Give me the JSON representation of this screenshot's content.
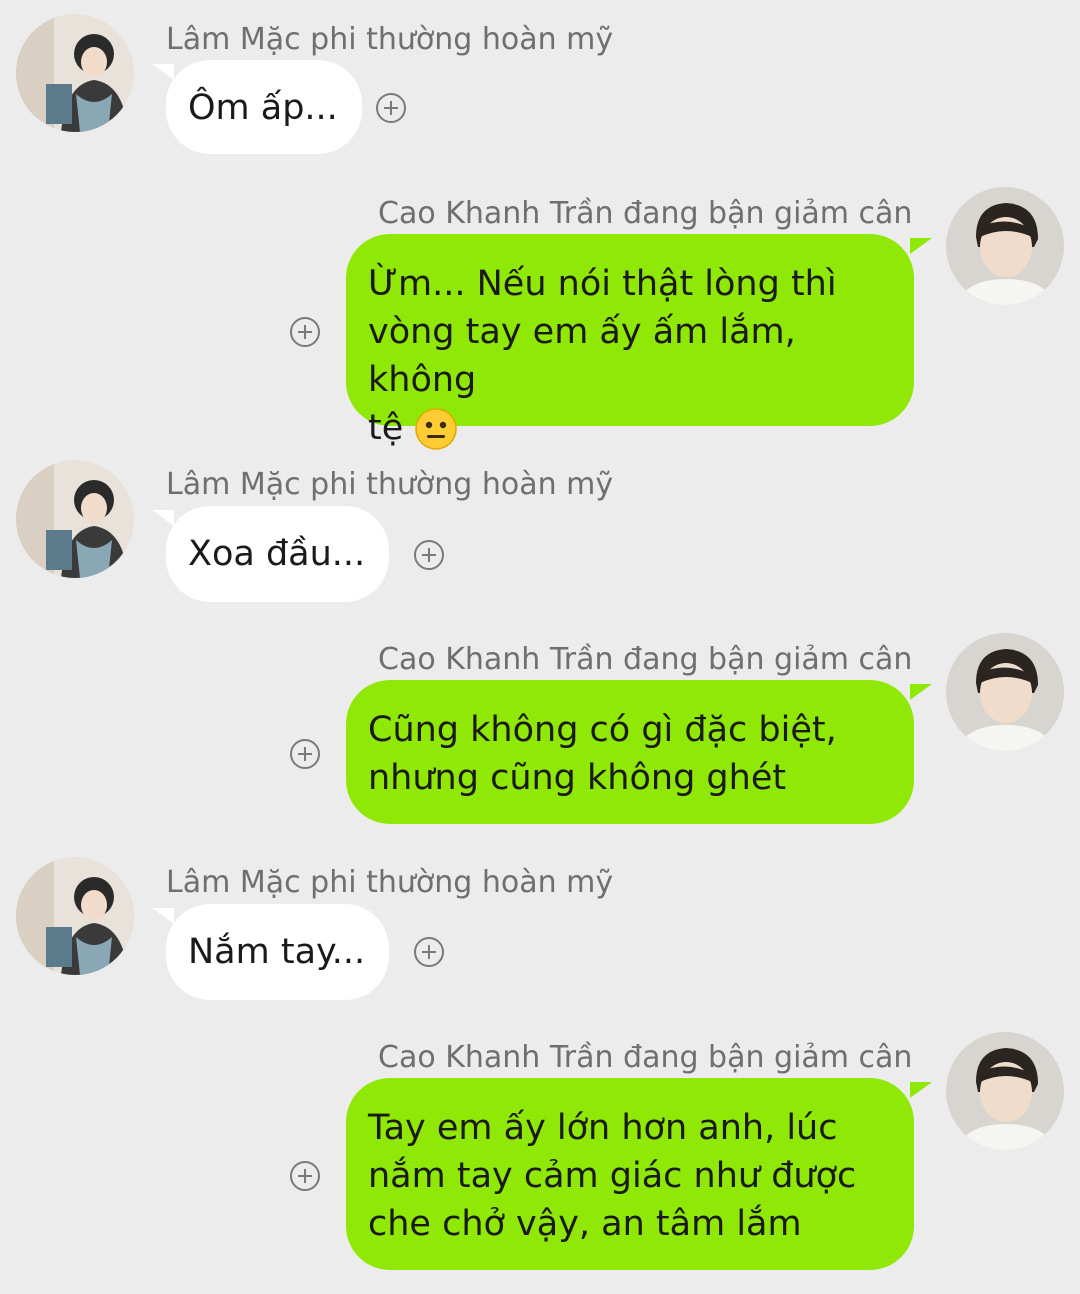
{
  "contacts": {
    "lam_mac": {
      "name": "Lâm Mặc phi thường hoàn mỹ"
    },
    "cao_khanh_tran": {
      "name": "Cao Khanh Trần đang bận giảm cân"
    }
  },
  "messages": [
    {
      "side": "left",
      "sender": "Lâm Mặc phi thường hoàn mỹ",
      "text": "Ôm ấp..."
    },
    {
      "side": "right",
      "sender": "Cao Khanh Trần đang bận giảm cân",
      "text_lines": [
        "Ừm... Nếu nói thật lòng thì",
        "vòng tay em ấy ấm lắm, không",
        "tệ"
      ],
      "emoji": "neutral-face"
    },
    {
      "side": "left",
      "sender": "Lâm Mặc phi thường hoàn mỹ",
      "text": "Xoa đầu..."
    },
    {
      "side": "right",
      "sender": "Cao Khanh Trần đang bận giảm cân",
      "text_lines": [
        "Cũng không có gì đặc biệt,",
        "nhưng cũng không ghét"
      ]
    },
    {
      "side": "left",
      "sender": "Lâm Mặc phi thường hoàn mỹ",
      "text": "Nắm tay..."
    },
    {
      "side": "right",
      "sender": "Cao Khanh Trần đang bận giảm cân",
      "text_lines": [
        "Tay em ấy lớn hơn anh, lúc",
        "nắm tay cảm giác như được",
        "che chở vậy, an tâm lắm"
      ]
    }
  ],
  "colors": {
    "background": "#ececec",
    "left_bubble": "#ffffff",
    "right_bubble": "#8fe806",
    "sender_text": "#6f6f6f"
  },
  "icons": {
    "add": "plus-circle-icon",
    "avatar_left": "avatar-lam-mac",
    "avatar_right": "avatar-cao-khanh-tran"
  }
}
